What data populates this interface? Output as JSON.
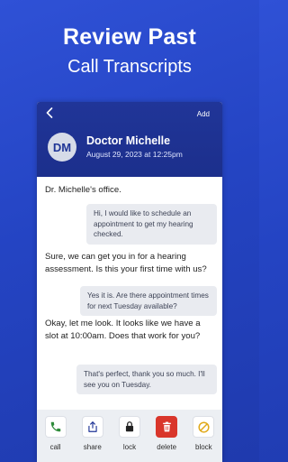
{
  "hero": {
    "title": "Review Past",
    "subtitle": "Call Transcripts"
  },
  "topbar": {
    "back_icon": "chevron-left-icon",
    "add_label": "Add"
  },
  "contact": {
    "initials": "DM",
    "name": "Doctor Michelle",
    "datetime": "August 29, 2023 at 12:25pm"
  },
  "transcript": [
    {
      "side": "left",
      "text": "Dr. Michelle's office."
    },
    {
      "side": "right",
      "text": "Hi, I would like to schedule an appointment to get my hearing checked."
    },
    {
      "side": "left",
      "text": "Sure, we can get you in for a hearing assessment. Is this your first time with us?"
    },
    {
      "side": "right",
      "text": "Yes it is. Are there appointment times for next Tuesday available?"
    },
    {
      "side": "left",
      "text": "Okay, let me look. It looks like we have a slot at 10:00am. Does that work for you?"
    },
    {
      "side": "right",
      "text": "That's perfect, thank you so much. I'll see you on Tuesday."
    }
  ],
  "actions": [
    {
      "label": "call",
      "icon": "phone-icon",
      "color": "#2e8b3a"
    },
    {
      "label": "share",
      "icon": "share-icon",
      "color": "#1f3496"
    },
    {
      "label": "lock",
      "icon": "lock-icon",
      "color": "#222222"
    },
    {
      "label": "delete",
      "icon": "trash-icon",
      "color": "#d9362b"
    },
    {
      "label": "block",
      "icon": "block-icon",
      "color": "#e0a91a"
    }
  ],
  "colors": {
    "background": "#2a48c9",
    "header": "#1f3496",
    "bubble": "#e9ebf0"
  }
}
